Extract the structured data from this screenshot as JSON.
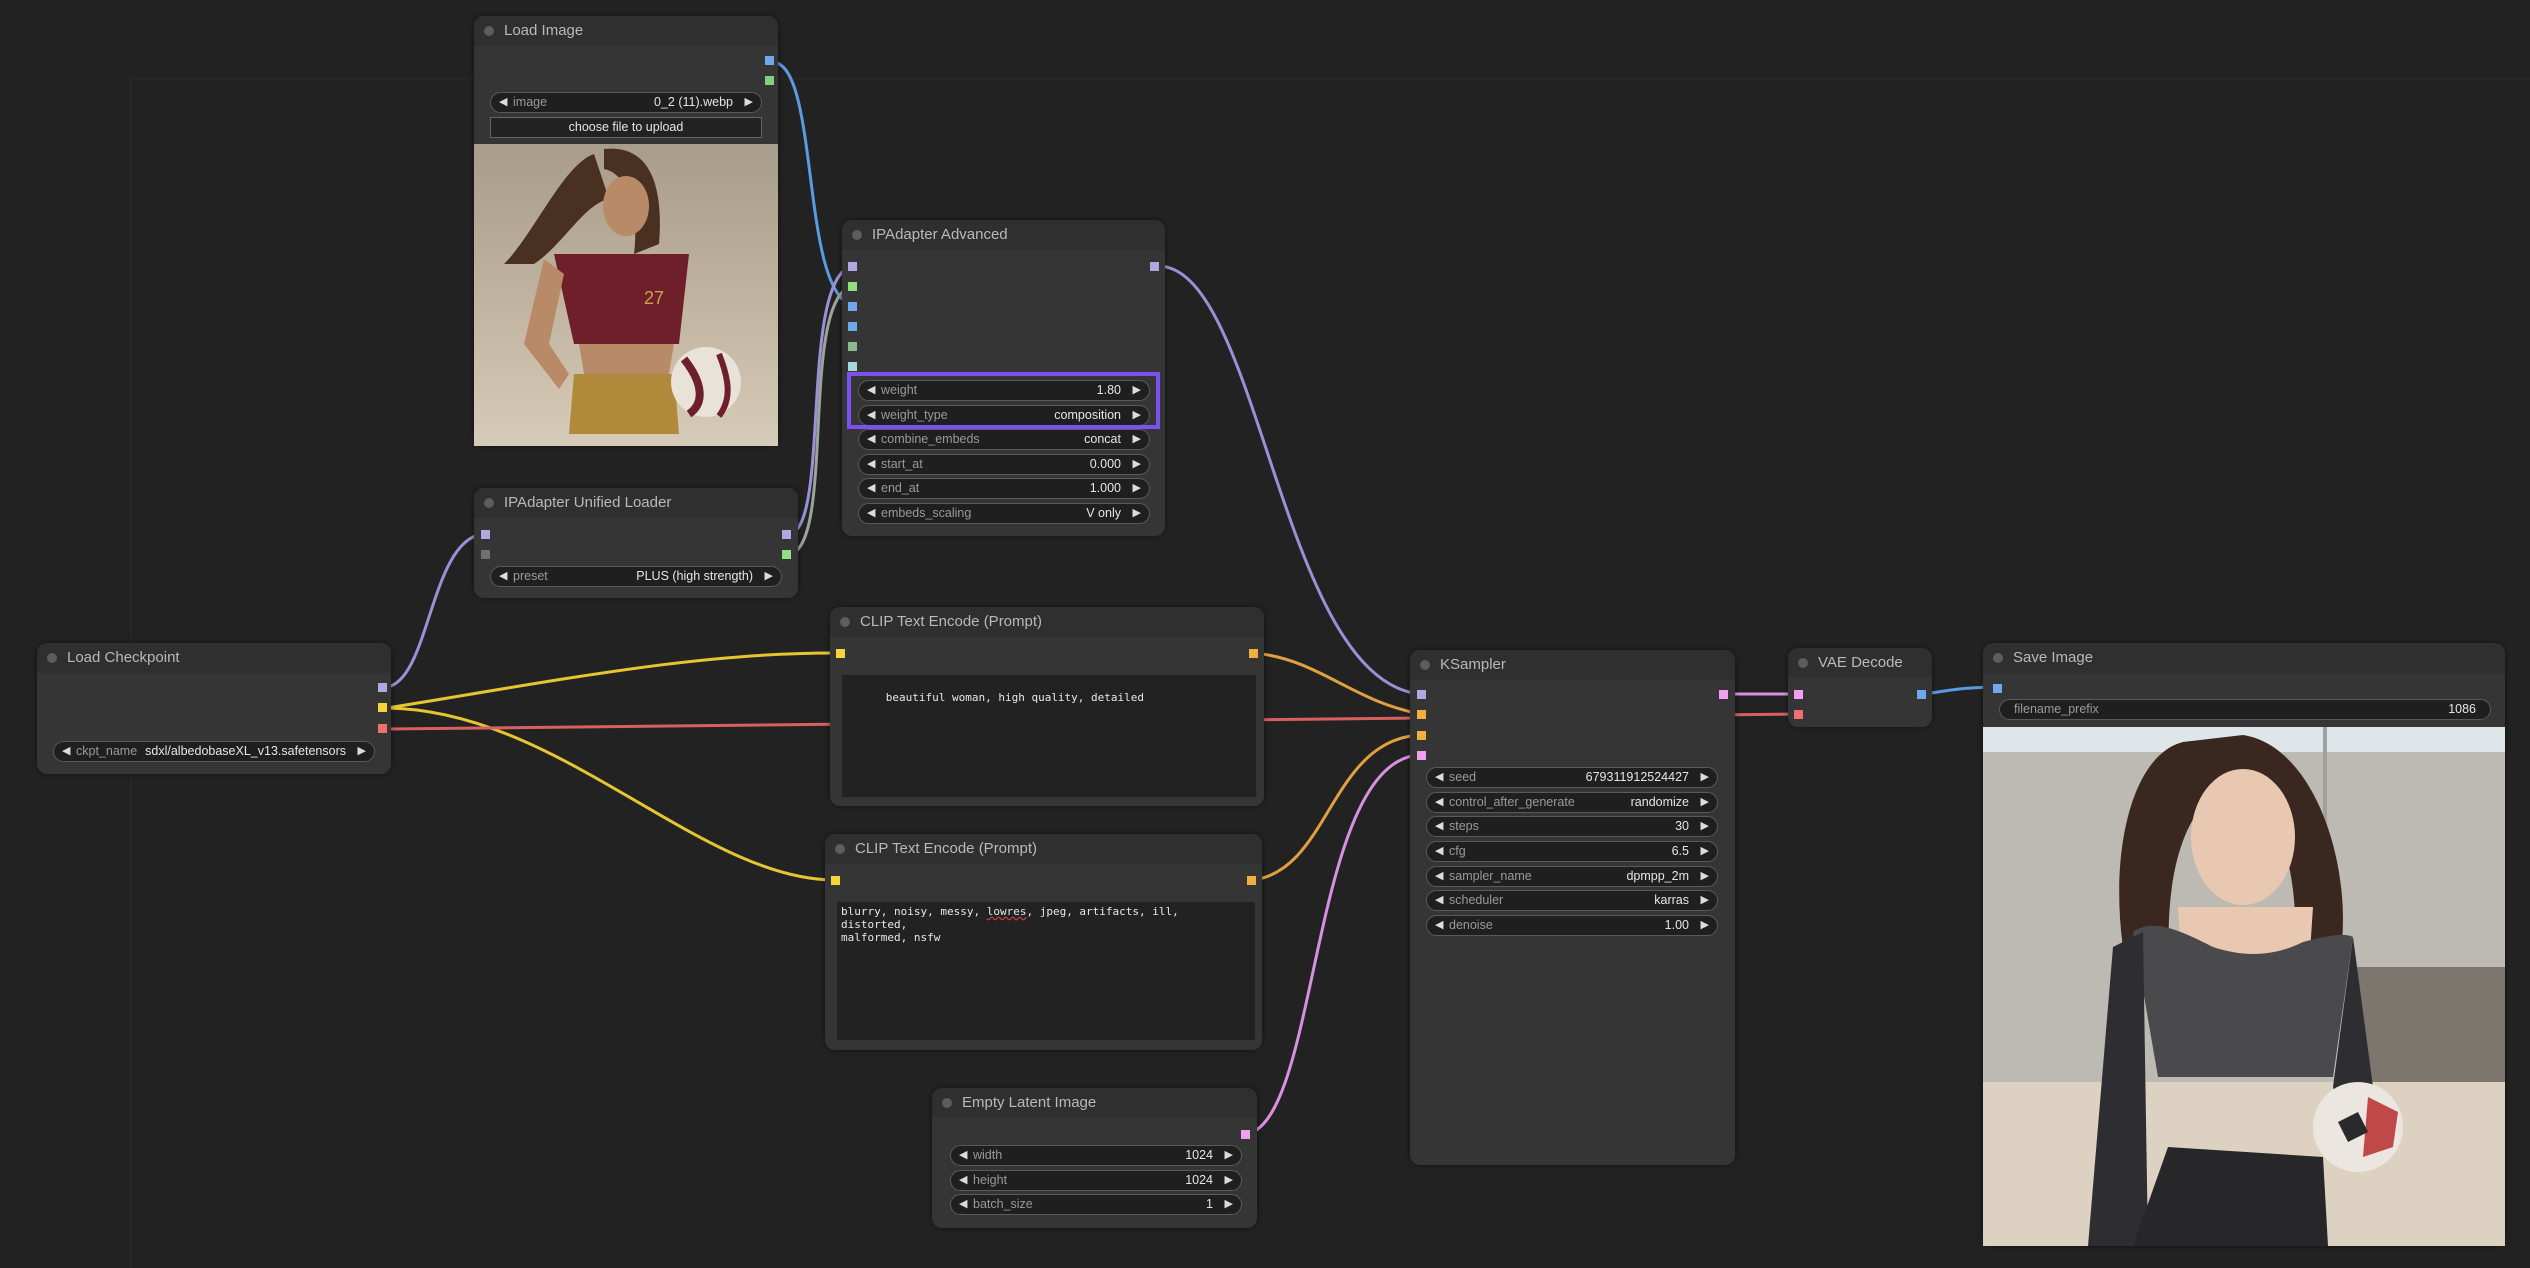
{
  "app": "ComfyUI",
  "colors": {
    "background": "#222222",
    "node_body": "#353535",
    "node_title": "#2f2f2f",
    "highlight": "#7b4ff0",
    "model_slot": "#b0a8e0",
    "clip_slot": "#f5d53a",
    "vae_slot": "#f07070",
    "image_slot": "#70a8f0",
    "mask_slot": "#80d080",
    "conditioning_slot": "#f0b040",
    "latent_slot": "#f0a0f0",
    "ipadapter_slot": "#90e080"
  },
  "nodes": {
    "load_image": {
      "title": "Load Image",
      "widgets": [
        {
          "label": "image",
          "value": "0_2 (11).webp"
        }
      ],
      "upload_label": "choose file to upload",
      "preview_description": "woman in maroon soccer jersey number 27 holding ball"
    },
    "ipadapter_loader": {
      "title": "IPAdapter Unified Loader",
      "widgets": [
        {
          "label": "preset",
          "value": "PLUS (high strength)"
        }
      ]
    },
    "ipadapter_advanced": {
      "title": "IPAdapter Advanced",
      "widgets": [
        {
          "label": "weight",
          "value": "1.80"
        },
        {
          "label": "weight_type",
          "value": "composition"
        },
        {
          "label": "combine_embeds",
          "value": "concat"
        },
        {
          "label": "start_at",
          "value": "0.000"
        },
        {
          "label": "end_at",
          "value": "1.000"
        },
        {
          "label": "embeds_scaling",
          "value": "V only"
        }
      ]
    },
    "load_checkpoint": {
      "title": "Load Checkpoint",
      "widgets": [
        {
          "label": "ckpt_name",
          "value": "sdxl/albedobaseXL_v13.safetensors"
        }
      ]
    },
    "clip_positive": {
      "title": "CLIP Text Encode (Prompt)",
      "text": "beautiful woman, high quality, detailed"
    },
    "clip_negative": {
      "title": "CLIP Text Encode (Prompt)",
      "text_before": "blurry, noisy, messy, ",
      "text_misspelled": "lowres",
      "text_after": ", jpeg, artifacts, ill, distorted,\nmalformed, nsfw"
    },
    "empty_latent": {
      "title": "Empty Latent Image",
      "widgets": [
        {
          "label": "width",
          "value": "1024"
        },
        {
          "label": "height",
          "value": "1024"
        },
        {
          "label": "batch_size",
          "value": "1"
        }
      ]
    },
    "ksampler": {
      "title": "KSampler",
      "widgets": [
        {
          "label": "seed",
          "value": "679311912524427"
        },
        {
          "label": "control_after_generate",
          "value": "randomize"
        },
        {
          "label": "steps",
          "value": "30"
        },
        {
          "label": "cfg",
          "value": "6.5"
        },
        {
          "label": "sampler_name",
          "value": "dpmpp_2m"
        },
        {
          "label": "scheduler",
          "value": "karras"
        },
        {
          "label": "denoise",
          "value": "1.00"
        }
      ]
    },
    "vae_decode": {
      "title": "VAE Decode"
    },
    "save_image": {
      "title": "Save Image",
      "widgets": [
        {
          "label": "filename_prefix",
          "value": "1086"
        }
      ],
      "preview_description": "woman in black crop top holding soccer ball"
    }
  },
  "icons": {
    "arrow_left": "◀",
    "arrow_right": "▶"
  }
}
